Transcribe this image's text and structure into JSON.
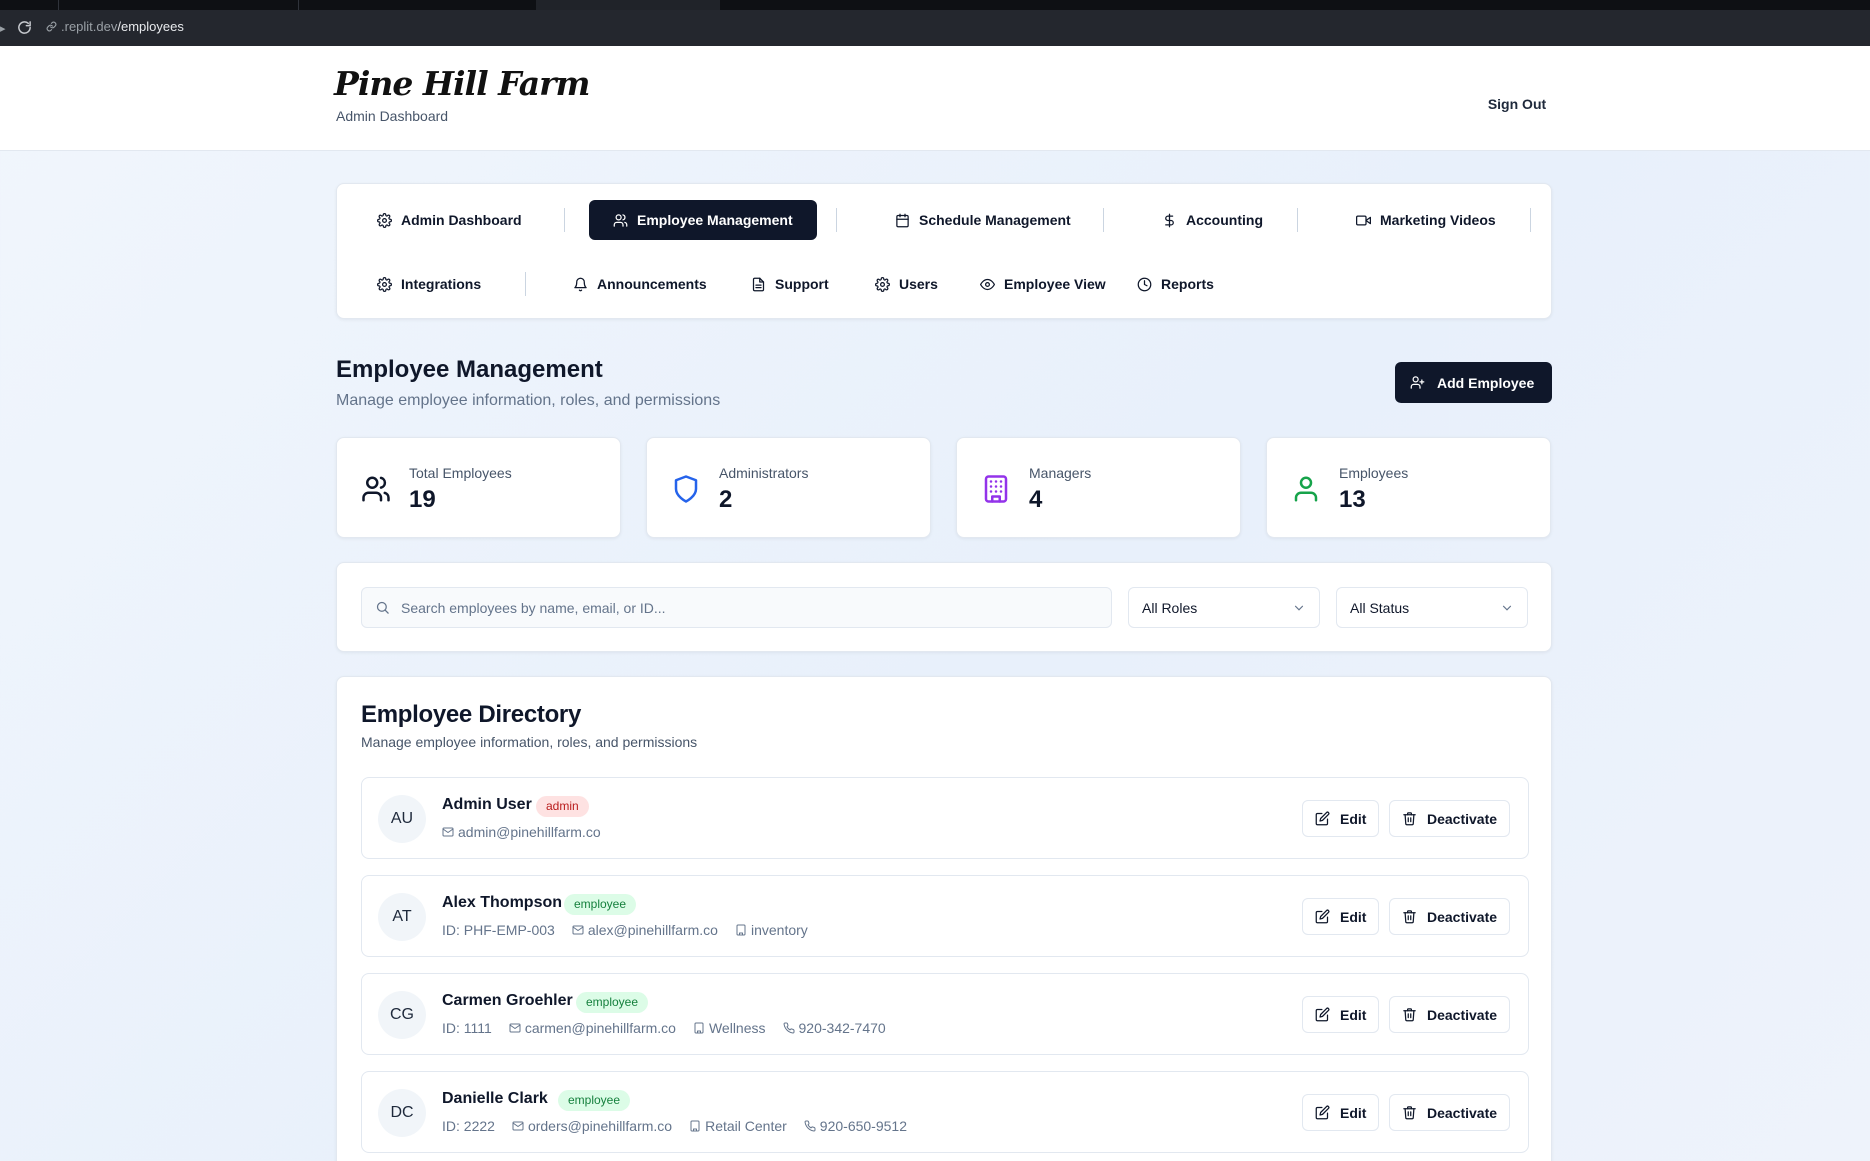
{
  "browser": {
    "url_domain": ".replit.dev",
    "url_path": "/employees"
  },
  "header": {
    "brand": "Pine Hill Farm",
    "subtitle": "Admin Dashboard",
    "sign_out": "Sign Out"
  },
  "nav": {
    "items": [
      {
        "label": "Admin Dashboard",
        "icon": "gear-icon"
      },
      {
        "label": "Employee Management",
        "icon": "users-icon",
        "active": true
      },
      {
        "label": "Schedule Management",
        "icon": "calendar-icon"
      },
      {
        "label": "Accounting",
        "icon": "dollar-icon"
      },
      {
        "label": "Marketing Videos",
        "icon": "video-icon"
      },
      {
        "label": "Integrations",
        "icon": "gear-icon"
      },
      {
        "label": "Announcements",
        "icon": "bell-icon"
      },
      {
        "label": "Support",
        "icon": "document-icon"
      },
      {
        "label": "Users",
        "icon": "gear-icon"
      },
      {
        "label": "Employee View",
        "icon": "eye-icon"
      },
      {
        "label": "Reports",
        "icon": "clock-icon"
      }
    ]
  },
  "page": {
    "title": "Employee Management",
    "subtitle": "Manage employee information, roles, and permissions",
    "add_button": "Add Employee"
  },
  "stats": [
    {
      "label": "Total Employees",
      "value": "19",
      "icon": "users-icon",
      "color": "#0f172a"
    },
    {
      "label": "Administrators",
      "value": "2",
      "icon": "shield-icon",
      "color": "#2563eb"
    },
    {
      "label": "Managers",
      "value": "4",
      "icon": "building-icon",
      "color": "#9333ea"
    },
    {
      "label": "Employees",
      "value": "13",
      "icon": "user-icon",
      "color": "#16a34a"
    }
  ],
  "filters": {
    "search_placeholder": "Search employees by name, email, or ID...",
    "role_selected": "All Roles",
    "status_selected": "All Status"
  },
  "directory": {
    "title": "Employee Directory",
    "subtitle": "Manage employee information, roles, and permissions",
    "edit_label": "Edit",
    "deactivate_label": "Deactivate",
    "rows": [
      {
        "initials": "AU",
        "name": "Admin User",
        "role": "admin",
        "id": "",
        "email": "admin@pinehillfarm.co",
        "department": "",
        "phone": ""
      },
      {
        "initials": "AT",
        "name": "Alex Thompson",
        "role": "employee",
        "id": "ID: PHF-EMP-003",
        "email": "alex@pinehillfarm.co",
        "department": "inventory",
        "phone": ""
      },
      {
        "initials": "CG",
        "name": "Carmen Groehler",
        "role": "employee",
        "id": "ID: 1111",
        "email": "carmen@pinehillfarm.co",
        "department": "Wellness",
        "phone": "920-342-7470"
      },
      {
        "initials": "DC",
        "name": "Danielle Clark",
        "role": "employee",
        "id": "ID: 2222",
        "email": "orders@pinehillfarm.co",
        "department": "Retail Center",
        "phone": "920-650-9512"
      }
    ]
  },
  "colors": {
    "primary": "#0f172a",
    "admin_badge_bg": "#fee2e2",
    "admin_badge_text": "#b91c1c",
    "employee_badge_bg": "#dcfce7",
    "employee_badge_text": "#15803d"
  }
}
